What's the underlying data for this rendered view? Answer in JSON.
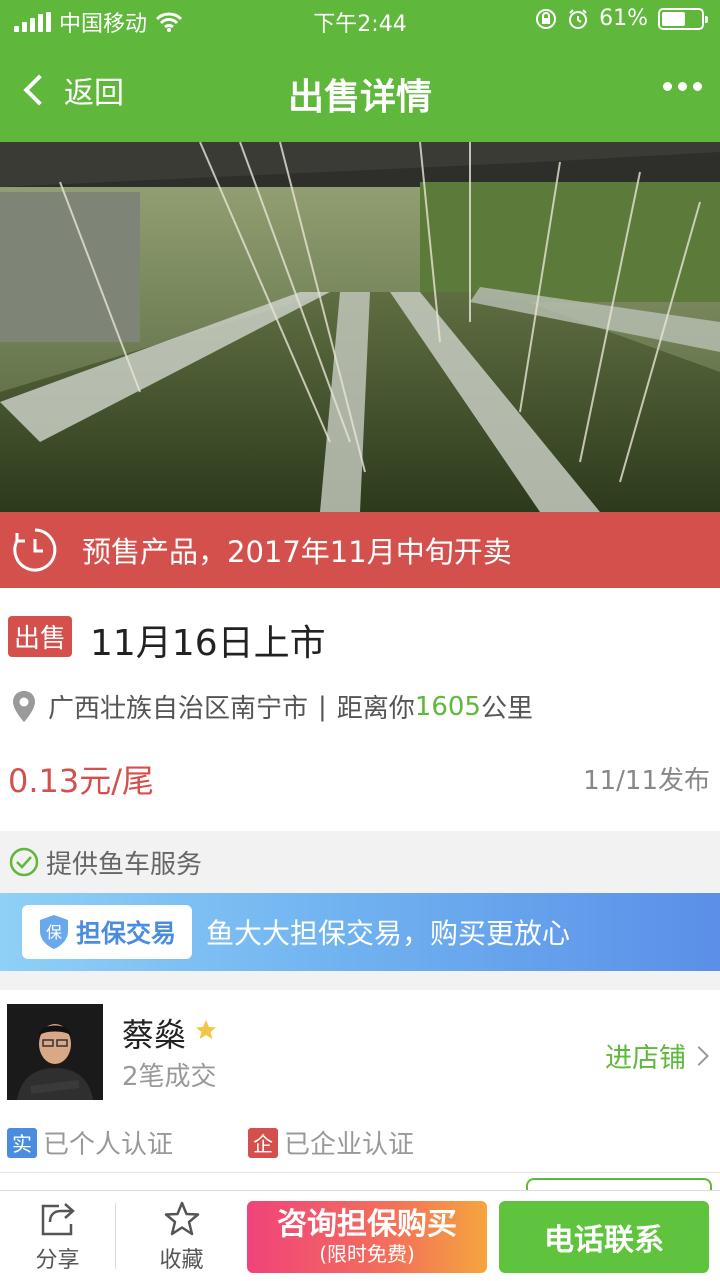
{
  "status_bar": {
    "carrier": "中国移动",
    "time": "下午2:44",
    "battery": "61%",
    "battery_level": 0.61
  },
  "nav": {
    "back_label": "返回",
    "title": "出售详情"
  },
  "presale": {
    "text": "预售产品，2017年11月中旬开卖"
  },
  "listing": {
    "tag": "出售",
    "title": "11月16日上市",
    "location": "广西壮族自治区南宁市",
    "separator": "|",
    "distance_prefix": "距离你",
    "distance_value": "1605",
    "distance_unit": "公里",
    "price": "0.13元/尾",
    "published": "11/11发布"
  },
  "service": {
    "text": "提供鱼车服务"
  },
  "guarantee": {
    "badge_char": "保",
    "badge_label": "担保交易",
    "text": "鱼大大担保交易，购买更放心"
  },
  "seller": {
    "name": "蔡燊",
    "deals": "2笔成交",
    "shop_link": "进店铺",
    "personal_char": "实",
    "personal_label": "已个人认证",
    "company_char": "企",
    "company_label": "已企业认证"
  },
  "bottom_bar": {
    "share": "分享",
    "favorite": "收藏",
    "consult_main": "咨询担保购买",
    "consult_sub": "(限时免费)",
    "call": "电话联系"
  },
  "colors": {
    "brand_green": "#5fb83b",
    "alert_red": "#d4504d",
    "guarantee_blue": "#5b8fe8"
  }
}
